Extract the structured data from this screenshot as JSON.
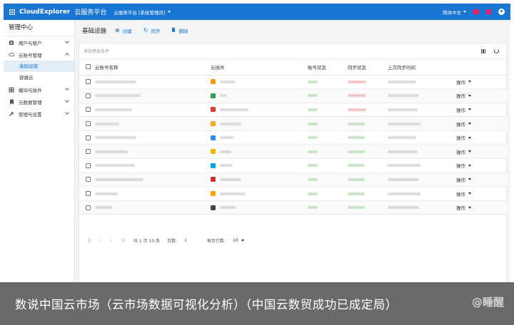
{
  "topbar": {
    "brand": "CloudExplorer",
    "subtitle": "云服务平台",
    "org_select": "云服务平台 [系统管理员]",
    "language": "简体中文",
    "bg_color": "#1976d2"
  },
  "sidebar": {
    "title": "管理中心",
    "items": [
      {
        "label": "用户与租户",
        "icon": "user-icon",
        "expanded": false
      },
      {
        "label": "云账号管理",
        "icon": "cloud-icon",
        "expanded": true,
        "children": [
          {
            "label": "基础设施",
            "active": true
          },
          {
            "label": "容器云",
            "active": false
          }
        ]
      },
      {
        "label": "模块与插件",
        "icon": "grid-icon",
        "expanded": false
      },
      {
        "label": "元数据管理",
        "icon": "bookmark-icon",
        "expanded": false
      },
      {
        "label": "管理与设置",
        "icon": "wrench-icon",
        "expanded": false
      }
    ]
  },
  "toolbar": {
    "title": "基础设施",
    "create_label": "创建",
    "sync_label": "同步",
    "delete_label": "删除"
  },
  "filter": {
    "placeholder": "添加筛选条件"
  },
  "table": {
    "columns": [
      "云账号名称",
      "云插件",
      "账号状态",
      "同步状态",
      "上次同步时间",
      ""
    ],
    "op_label": "操作",
    "rows": [
      {
        "plugin_icon_color": "#ff9900"
      },
      {
        "plugin_icon_color": "#2e9f5b"
      },
      {
        "plugin_icon_color": "#e53935"
      },
      {
        "plugin_icon_color": "#f5a623"
      },
      {
        "plugin_icon_color": "#2d8cf0"
      },
      {
        "plugin_icon_color": "#f4b400"
      },
      {
        "plugin_icon_color": "#00a4ef"
      },
      {
        "plugin_icon_color": "#d32f2f"
      },
      {
        "plugin_icon_color": "#ffa000"
      },
      {
        "plugin_icon_color": "#444444"
      }
    ]
  },
  "pager": {
    "summary": "共 1 页 10 条",
    "page_label": "页数:",
    "page_value": "1",
    "per_page_label": "每页行数:",
    "per_page_value": "10"
  },
  "caption": {
    "text": "数说中国云市场（云市场数据可视化分析）（中国云数贸成功已成定局）",
    "watermark": "@睡醒"
  }
}
